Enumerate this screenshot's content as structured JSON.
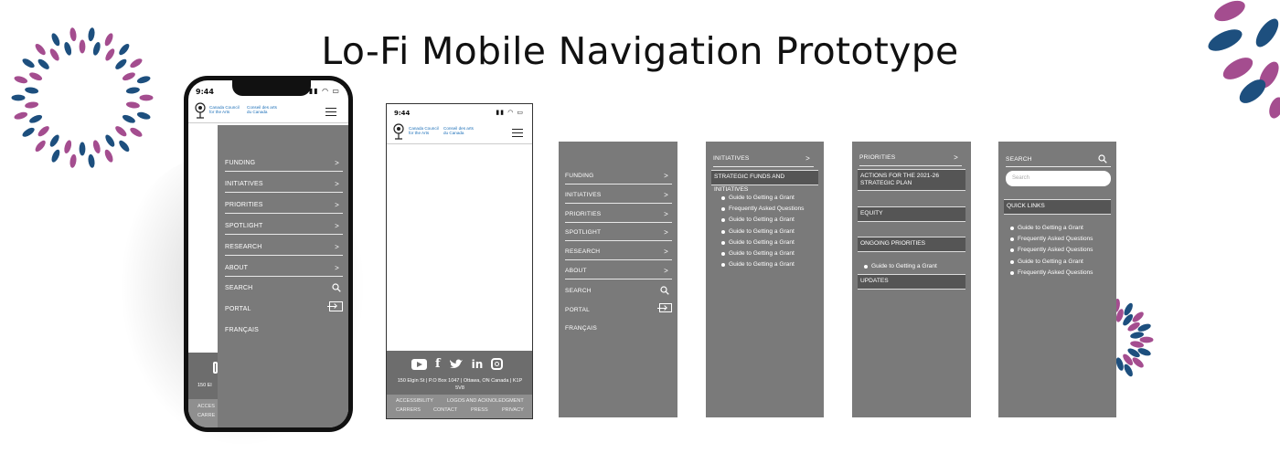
{
  "page": {
    "title": "Lo-Fi Mobile Navigation Prototype"
  },
  "colors": {
    "panel_gray": "#7a7a7a",
    "dark_block": "#555555",
    "deco_purple": "#a44d8f",
    "deco_navy": "#1d4f7e"
  },
  "status": {
    "time": "9:44",
    "icons": "signal wifi battery"
  },
  "logo": {
    "en": "Canada Council\nfor the Arts",
    "fr": "Conseil des arts\ndu Canada",
    "icon": "canada-council-logo-icon"
  },
  "menu": {
    "items": [
      {
        "label": "FUNDING",
        "chevron": ">"
      },
      {
        "label": "INITIATIVES",
        "chevron": ">"
      },
      {
        "label": "PRIORITIES",
        "chevron": ">"
      },
      {
        "label": "SPOTLIGHT",
        "chevron": ">"
      },
      {
        "label": "RESEARCH",
        "chevron": ">"
      },
      {
        "label": "ABOUT",
        "chevron": ">"
      }
    ],
    "search": "SEARCH",
    "portal": "PORTAL",
    "francais": "FRANÇAIS"
  },
  "footer": {
    "social_icons": [
      "youtube-icon",
      "facebook-icon",
      "twitter-icon",
      "linkedin-icon",
      "instagram-icon"
    ],
    "address": "150 Elgin St | P.O Box 1047 | Ottawa, ON Canada | K1P 5V8",
    "links_row1": [
      "ACCESSIBILITY",
      "LOGOS AND ACKNOLEDGMENT"
    ],
    "links_row2": [
      "CARRERS",
      "CONTACT",
      "PRESS",
      "PRIVACY"
    ],
    "phone_address_fragment": "150 El",
    "phone_links_fragment": [
      "ACCES",
      "CARRE"
    ]
  },
  "initiatives": {
    "header": "INITIATIVES",
    "chevron": ">",
    "block": "STRATEGIC FUNDS AND INITIATIVES",
    "links": [
      "Guide to Getting a Grant",
      "Frequently Asked Questions",
      "Guide to Getting a Grant",
      "Guide to Getting a Grant",
      "Guide to Getting a Grant",
      "Guide to Getting a Grant",
      "Guide to Getting a Grant"
    ]
  },
  "priorities": {
    "header": "PRIORITIES",
    "chevron": ">",
    "block_actions": "ACTIONS FOR THE 2021-26\nSTRATEGIC PLAN",
    "block_equity": "EQUITY",
    "block_ongoing": "ONGOING PRIORITIES",
    "ongoing_link": "Guide to Getting a Grant",
    "block_updates": "UPDATES"
  },
  "search_panel": {
    "label": "SEARCH",
    "placeholder": "Search",
    "quick_links": "QUICK LINKS",
    "links": [
      "Guide to Getting a Grant",
      "Frequently Asked Questions",
      "Frequently Asked Questions",
      "Guide to Getting a Grant",
      "Frequently Asked Questions"
    ]
  }
}
